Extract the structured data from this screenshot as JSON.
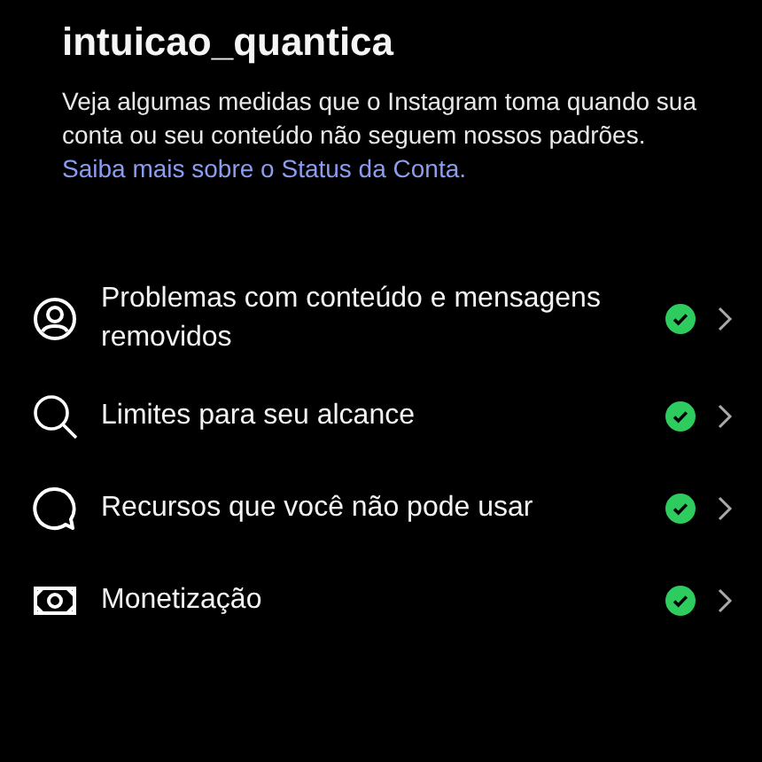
{
  "title": "intuicao_quantica",
  "description": {
    "text": "Veja algumas medidas que o Instagram toma quando sua conta ou seu conteúdo não seguem nossos padrões.",
    "link": "Saiba mais sobre o Status da Conta."
  },
  "items": [
    {
      "kind": "person",
      "label": "Problemas com conteúdo e mensagens removidos",
      "ok": true
    },
    {
      "kind": "search",
      "label": "Limites para seu alcance",
      "ok": true
    },
    {
      "kind": "chat",
      "label": "Recursos que você não pode usar",
      "ok": true
    },
    {
      "kind": "money",
      "label": "Monetização",
      "ok": true
    }
  ]
}
